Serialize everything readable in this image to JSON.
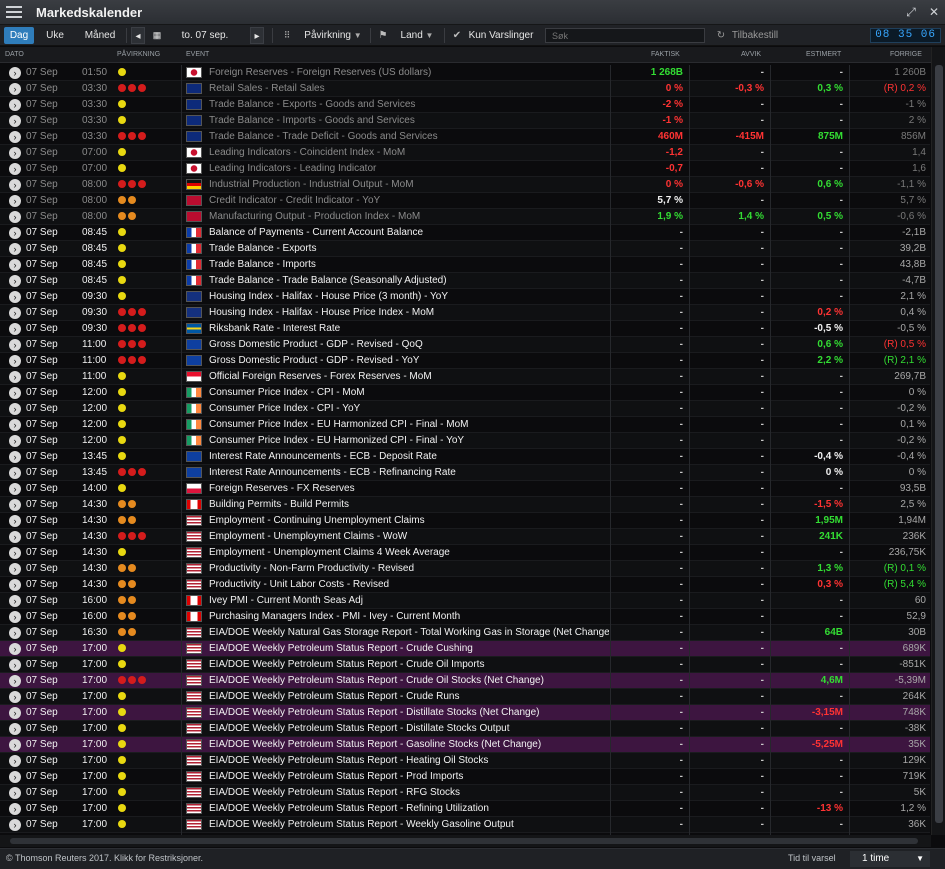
{
  "window": {
    "title": "Markedskalender",
    "menu_icon": "hamburger-icon",
    "restore_icon": "restore-icon",
    "close_icon": "close-icon"
  },
  "toolbar": {
    "tabs": [
      "Dag",
      "Uke",
      "Måned"
    ],
    "active_tab": "Dag",
    "date": "to. 07 sep.",
    "impact_label": "Påvirkning",
    "country_label": "Land",
    "alerts_label": "Kun Varslinger",
    "search_placeholder": "Søk",
    "reset_label": "Tilbakestill",
    "clock": "08 35 06"
  },
  "columns": {
    "date": "DATO",
    "impact": "PÅVIRKNING",
    "event": "EVENT",
    "actual": "FAKTISK",
    "deviation": "AVVIK",
    "estimate": "ESTIMERT",
    "previous": "FORRIGE"
  },
  "colors": {
    "positive": "#33dd33",
    "negative": "#ff3333",
    "impact_high": "#d41c1c",
    "impact_med": "#e58a1f",
    "impact_low": "#e8d810",
    "highlight_row": "#3d1540"
  },
  "rows": [
    {
      "date": "07 Sep",
      "time": "01:50",
      "impact": 1,
      "flag": "jp",
      "event": "Foreign Reserves - Foreign Reserves (US dollars)",
      "actual": "1 268B",
      "act_c": "pos",
      "dev": "-",
      "dev_c": "",
      "est": "-",
      "est_c": "",
      "prev": "1 260B",
      "style": "dim"
    },
    {
      "date": "07 Sep",
      "time": "03:30",
      "impact": 3,
      "flag": "au",
      "event": "Retail Sales - Retail Sales",
      "actual": "0 %",
      "act_c": "neg",
      "dev": "-0,3 %",
      "dev_c": "neg",
      "est": "0,3 %",
      "est_c": "pos",
      "prev": "(R) 0,2 %",
      "prev_c": "neg",
      "style": "dim"
    },
    {
      "date": "07 Sep",
      "time": "03:30",
      "impact": 1,
      "flag": "au",
      "event": "Trade Balance - Exports - Goods and Services",
      "actual": "-2 %",
      "act_c": "neg",
      "dev": "-",
      "dev_c": "",
      "est": "-",
      "est_c": "",
      "prev": "-1 %",
      "style": "dim"
    },
    {
      "date": "07 Sep",
      "time": "03:30",
      "impact": 1,
      "flag": "au",
      "event": "Trade Balance - Imports - Goods and Services",
      "actual": "-1 %",
      "act_c": "neg",
      "dev": "-",
      "dev_c": "",
      "est": "-",
      "est_c": "",
      "prev": "2 %",
      "style": "dim"
    },
    {
      "date": "07 Sep",
      "time": "03:30",
      "impact": 3,
      "flag": "au",
      "event": "Trade Balance - Trade Deficit - Goods and Services",
      "actual": "460M",
      "act_c": "neg",
      "dev": "-415M",
      "dev_c": "neg",
      "est": "875M",
      "est_c": "pos",
      "prev": "856M",
      "style": "dim"
    },
    {
      "date": "07 Sep",
      "time": "07:00",
      "impact": 1,
      "flag": "jp",
      "event": "Leading Indicators - Coincident Index - MoM",
      "actual": "-1,2",
      "act_c": "neg",
      "dev": "-",
      "dev_c": "",
      "est": "-",
      "est_c": "",
      "prev": "1,4",
      "style": "dim"
    },
    {
      "date": "07 Sep",
      "time": "07:00",
      "impact": 1,
      "flag": "jp",
      "event": "Leading Indicators - Leading Indicator",
      "actual": "-0,7",
      "act_c": "neg",
      "dev": "-",
      "dev_c": "",
      "est": "-",
      "est_c": "",
      "prev": "1,6",
      "style": "dim"
    },
    {
      "date": "07 Sep",
      "time": "08:00",
      "impact": 3,
      "flag": "de",
      "event": "Industrial Production - Industrial Output - MoM",
      "actual": "0 %",
      "act_c": "neg",
      "dev": "-0,6 %",
      "dev_c": "neg",
      "est": "0,6 %",
      "est_c": "pos",
      "prev": "-1,1 %",
      "style": "dim"
    },
    {
      "date": "07 Sep",
      "time": "08:00",
      "impact": 2,
      "flag": "no",
      "event": "Credit Indicator - Credit Indicator - YoY",
      "actual": "5,7 %",
      "act_c": "wht",
      "dev": "-",
      "dev_c": "",
      "est": "-",
      "est_c": "",
      "prev": "5,7 %",
      "style": "dim"
    },
    {
      "date": "07 Sep",
      "time": "08:00",
      "impact": 2,
      "flag": "no",
      "event": "Manufacturing Output - Production Index - MoM",
      "actual": "1,9 %",
      "act_c": "pos",
      "dev": "1,4 %",
      "dev_c": "pos",
      "est": "0,5 %",
      "est_c": "pos",
      "prev": "-0,6 %",
      "style": "dim"
    },
    {
      "date": "07 Sep",
      "time": "08:45",
      "impact": 1,
      "flag": "fr",
      "event": "Balance of Payments - Current Account Balance",
      "actual": "-",
      "act_c": "",
      "dev": "-",
      "dev_c": "",
      "est": "-",
      "est_c": "",
      "prev": "-2,1B",
      "style": "bold"
    },
    {
      "date": "07 Sep",
      "time": "08:45",
      "impact": 1,
      "flag": "fr",
      "event": "Trade Balance - Exports",
      "actual": "-",
      "act_c": "",
      "dev": "-",
      "dev_c": "",
      "est": "-",
      "est_c": "",
      "prev": "39,2B",
      "style": "bold"
    },
    {
      "date": "07 Sep",
      "time": "08:45",
      "impact": 1,
      "flag": "fr",
      "event": "Trade Balance - Imports",
      "actual": "-",
      "act_c": "",
      "dev": "-",
      "dev_c": "",
      "est": "-",
      "est_c": "",
      "prev": "43,8B",
      "style": "bold"
    },
    {
      "date": "07 Sep",
      "time": "08:45",
      "impact": 1,
      "flag": "fr",
      "event": "Trade Balance - Trade Balance (Seasonally Adjusted)",
      "actual": "-",
      "act_c": "",
      "dev": "-",
      "dev_c": "",
      "est": "-",
      "est_c": "",
      "prev": "-4,7B",
      "style": "bold"
    },
    {
      "date": "07 Sep",
      "time": "09:30",
      "impact": 1,
      "flag": "gb",
      "event": "Housing Index - Halifax - House Price (3 month) - YoY",
      "actual": "-",
      "act_c": "",
      "dev": "-",
      "dev_c": "",
      "est": "-",
      "est_c": "",
      "prev": "2,1 %",
      "style": "bold"
    },
    {
      "date": "07 Sep",
      "time": "09:30",
      "impact": 3,
      "flag": "gb",
      "event": "Housing Index - Halifax - House Price Index - MoM",
      "actual": "-",
      "act_c": "",
      "dev": "-",
      "dev_c": "",
      "est": "0,2 %",
      "est_c": "neg",
      "prev": "0,4 %",
      "style": "bold"
    },
    {
      "date": "07 Sep",
      "time": "09:30",
      "impact": 3,
      "flag": "se",
      "event": "Riksbank Rate - Interest Rate",
      "actual": "-",
      "act_c": "",
      "dev": "-",
      "dev_c": "",
      "est": "-0,5 %",
      "est_c": "wht",
      "prev": "-0,5 %",
      "style": "bold"
    },
    {
      "date": "07 Sep",
      "time": "11:00",
      "impact": 3,
      "flag": "eu",
      "event": "Gross Domestic Product - GDP - Revised - QoQ",
      "actual": "-",
      "act_c": "",
      "dev": "-",
      "dev_c": "",
      "est": "0,6 %",
      "est_c": "pos",
      "prev": "(R) 0,5 %",
      "prev_c": "neg",
      "style": "bold"
    },
    {
      "date": "07 Sep",
      "time": "11:00",
      "impact": 3,
      "flag": "eu",
      "event": "Gross Domestic Product - GDP - Revised - YoY",
      "actual": "-",
      "act_c": "",
      "dev": "-",
      "dev_c": "",
      "est": "2,2 %",
      "est_c": "pos",
      "prev": "(R) 2,1 %",
      "prev_c": "pos",
      "style": "bold"
    },
    {
      "date": "07 Sep",
      "time": "11:00",
      "impact": 1,
      "flag": "sg",
      "event": "Official Foreign Reserves - Forex Reserves - MoM",
      "actual": "-",
      "act_c": "",
      "dev": "-",
      "dev_c": "",
      "est": "-",
      "est_c": "",
      "prev": "269,7B",
      "style": "bold"
    },
    {
      "date": "07 Sep",
      "time": "12:00",
      "impact": 1,
      "flag": "ie",
      "event": "Consumer Price Index - CPI - MoM",
      "actual": "-",
      "act_c": "",
      "dev": "-",
      "dev_c": "",
      "est": "-",
      "est_c": "",
      "prev": "0 %",
      "style": "bold"
    },
    {
      "date": "07 Sep",
      "time": "12:00",
      "impact": 1,
      "flag": "ie",
      "event": "Consumer Price Index - CPI - YoY",
      "actual": "-",
      "act_c": "",
      "dev": "-",
      "dev_c": "",
      "est": "-",
      "est_c": "",
      "prev": "-0,2 %",
      "style": "bold"
    },
    {
      "date": "07 Sep",
      "time": "12:00",
      "impact": 1,
      "flag": "ie",
      "event": "Consumer Price Index - EU Harmonized CPI - Final - MoM",
      "actual": "-",
      "act_c": "",
      "dev": "-",
      "dev_c": "",
      "est": "-",
      "est_c": "",
      "prev": "0,1 %",
      "style": "bold"
    },
    {
      "date": "07 Sep",
      "time": "12:00",
      "impact": 1,
      "flag": "ie",
      "event": "Consumer Price Index - EU Harmonized CPI - Final - YoY",
      "actual": "-",
      "act_c": "",
      "dev": "-",
      "dev_c": "",
      "est": "-",
      "est_c": "",
      "prev": "-0,2 %",
      "style": "bold"
    },
    {
      "date": "07 Sep",
      "time": "13:45",
      "impact": 1,
      "flag": "eu",
      "event": "Interest Rate Announcements - ECB - Deposit Rate",
      "actual": "-",
      "act_c": "",
      "dev": "-",
      "dev_c": "",
      "est": "-0,4 %",
      "est_c": "wht",
      "prev": "-0,4 %",
      "style": "bold"
    },
    {
      "date": "07 Sep",
      "time": "13:45",
      "impact": 3,
      "flag": "eu",
      "event": "Interest Rate Announcements - ECB - Refinancing Rate",
      "actual": "-",
      "act_c": "",
      "dev": "-",
      "dev_c": "",
      "est": "0 %",
      "est_c": "wht",
      "prev": "0 %",
      "style": "bold"
    },
    {
      "date": "07 Sep",
      "time": "14:00",
      "impact": 1,
      "flag": "pl",
      "event": "Foreign Reserves - FX Reserves",
      "actual": "-",
      "act_c": "",
      "dev": "-",
      "dev_c": "",
      "est": "-",
      "est_c": "",
      "prev": "93,5B",
      "style": "bold"
    },
    {
      "date": "07 Sep",
      "time": "14:30",
      "impact": 2,
      "flag": "ca",
      "event": "Building Permits - Build Permits",
      "actual": "-",
      "act_c": "",
      "dev": "-",
      "dev_c": "",
      "est": "-1,5 %",
      "est_c": "neg",
      "prev": "2,5 %",
      "style": "bold"
    },
    {
      "date": "07 Sep",
      "time": "14:30",
      "impact": 2,
      "flag": "us",
      "event": "Employment - Continuing Unemployment Claims",
      "actual": "-",
      "act_c": "",
      "dev": "-",
      "dev_c": "",
      "est": "1,95M",
      "est_c": "pos",
      "prev": "1,94M",
      "style": "bold"
    },
    {
      "date": "07 Sep",
      "time": "14:30",
      "impact": 3,
      "flag": "us",
      "event": "Employment - Unemployment Claims - WoW",
      "actual": "-",
      "act_c": "",
      "dev": "-",
      "dev_c": "",
      "est": "241K",
      "est_c": "pos",
      "prev": "236K",
      "style": "bold"
    },
    {
      "date": "07 Sep",
      "time": "14:30",
      "impact": 1,
      "flag": "us",
      "event": "Employment - Unemployment Claims 4 Week Average",
      "actual": "-",
      "act_c": "",
      "dev": "-",
      "dev_c": "",
      "est": "-",
      "est_c": "",
      "prev": "236,75K",
      "style": "bold"
    },
    {
      "date": "07 Sep",
      "time": "14:30",
      "impact": 2,
      "flag": "us",
      "event": "Productivity - Non-Farm Productivity - Revised",
      "actual": "-",
      "act_c": "",
      "dev": "-",
      "dev_c": "",
      "est": "1,3 %",
      "est_c": "pos",
      "prev": "(R) 0,1 %",
      "prev_c": "pos",
      "style": "bold"
    },
    {
      "date": "07 Sep",
      "time": "14:30",
      "impact": 2,
      "flag": "us",
      "event": "Productivity - Unit Labor Costs - Revised",
      "actual": "-",
      "act_c": "",
      "dev": "-",
      "dev_c": "",
      "est": "0,3 %",
      "est_c": "neg",
      "prev": "(R) 5,4 %",
      "prev_c": "pos",
      "style": "bold"
    },
    {
      "date": "07 Sep",
      "time": "16:00",
      "impact": 2,
      "flag": "ca",
      "event": "Ivey PMI - Current Month Seas Adj",
      "actual": "-",
      "act_c": "",
      "dev": "-",
      "dev_c": "",
      "est": "-",
      "est_c": "",
      "prev": "60",
      "style": "bold"
    },
    {
      "date": "07 Sep",
      "time": "16:00",
      "impact": 2,
      "flag": "ca",
      "event": "Purchasing Managers Index - PMI - Ivey - Current Month",
      "actual": "-",
      "act_c": "",
      "dev": "-",
      "dev_c": "",
      "est": "-",
      "est_c": "",
      "prev": "52,9",
      "style": "bold"
    },
    {
      "date": "07 Sep",
      "time": "16:30",
      "impact": 2,
      "flag": "us",
      "event": "EIA/DOE Weekly Natural Gas Storage Report - Total Working Gas in Storage (Net Change)",
      "actual": "-",
      "act_c": "",
      "dev": "-",
      "dev_c": "",
      "est": "64B",
      "est_c": "pos",
      "prev": "30B",
      "style": "bold"
    },
    {
      "date": "07 Sep",
      "time": "17:00",
      "impact": 1,
      "flag": "us",
      "event": "EIA/DOE Weekly Petroleum Status Report - Crude Cushing",
      "actual": "-",
      "act_c": "",
      "dev": "-",
      "dev_c": "",
      "est": "-",
      "est_c": "",
      "prev": "689K",
      "style": "hl"
    },
    {
      "date": "07 Sep",
      "time": "17:00",
      "impact": 1,
      "flag": "us",
      "event": "EIA/DOE Weekly Petroleum Status Report - Crude Oil Imports",
      "actual": "-",
      "act_c": "",
      "dev": "-",
      "dev_c": "",
      "est": "-",
      "est_c": "",
      "prev": "-851K",
      "style": "bold"
    },
    {
      "date": "07 Sep",
      "time": "17:00",
      "impact": 3,
      "flag": "us",
      "event": "EIA/DOE Weekly Petroleum Status Report - Crude Oil Stocks (Net Change)",
      "actual": "-",
      "act_c": "",
      "dev": "-",
      "dev_c": "",
      "est": "4,6M",
      "est_c": "pos",
      "prev": "-5,39M",
      "style": "hl"
    },
    {
      "date": "07 Sep",
      "time": "17:00",
      "impact": 1,
      "flag": "us",
      "event": "EIA/DOE Weekly Petroleum Status Report - Crude Runs",
      "actual": "-",
      "act_c": "",
      "dev": "-",
      "dev_c": "",
      "est": "-",
      "est_c": "",
      "prev": "264K",
      "style": "bold"
    },
    {
      "date": "07 Sep",
      "time": "17:00",
      "impact": 1,
      "flag": "us",
      "event": "EIA/DOE Weekly Petroleum Status Report - Distillate Stocks (Net Change)",
      "actual": "-",
      "act_c": "",
      "dev": "-",
      "dev_c": "",
      "est": "-3,15M",
      "est_c": "neg",
      "prev": "748K",
      "style": "hl"
    },
    {
      "date": "07 Sep",
      "time": "17:00",
      "impact": 1,
      "flag": "us",
      "event": "EIA/DOE Weekly Petroleum Status Report - Distillate Stocks Output",
      "actual": "-",
      "act_c": "",
      "dev": "-",
      "dev_c": "",
      "est": "-",
      "est_c": "",
      "prev": "-38K",
      "style": "bold"
    },
    {
      "date": "07 Sep",
      "time": "17:00",
      "impact": 1,
      "flag": "us",
      "event": "EIA/DOE Weekly Petroleum Status Report - Gasoline Stocks (Net Change)",
      "actual": "-",
      "act_c": "",
      "dev": "-",
      "dev_c": "",
      "est": "-5,25M",
      "est_c": "neg",
      "prev": "35K",
      "style": "hl"
    },
    {
      "date": "07 Sep",
      "time": "17:00",
      "impact": 1,
      "flag": "us",
      "event": "EIA/DOE Weekly Petroleum Status Report - Heating Oil Stocks",
      "actual": "-",
      "act_c": "",
      "dev": "-",
      "dev_c": "",
      "est": "-",
      "est_c": "",
      "prev": "129K",
      "style": "bold"
    },
    {
      "date": "07 Sep",
      "time": "17:00",
      "impact": 1,
      "flag": "us",
      "event": "EIA/DOE Weekly Petroleum Status Report - Prod Imports",
      "actual": "-",
      "act_c": "",
      "dev": "-",
      "dev_c": "",
      "est": "-",
      "est_c": "",
      "prev": "719K",
      "style": "bold"
    },
    {
      "date": "07 Sep",
      "time": "17:00",
      "impact": 1,
      "flag": "us",
      "event": "EIA/DOE Weekly Petroleum Status Report - RFG Stocks",
      "actual": "-",
      "act_c": "",
      "dev": "-",
      "dev_c": "",
      "est": "-",
      "est_c": "",
      "prev": "5K",
      "style": "bold"
    },
    {
      "date": "07 Sep",
      "time": "17:00",
      "impact": 1,
      "flag": "us",
      "event": "EIA/DOE Weekly Petroleum Status Report - Refining Utilization",
      "actual": "-",
      "act_c": "",
      "dev": "-",
      "dev_c": "",
      "est": "-13 %",
      "est_c": "neg",
      "prev": "1,2 %",
      "style": "bold"
    },
    {
      "date": "07 Sep",
      "time": "17:00",
      "impact": 1,
      "flag": "us",
      "event": "EIA/DOE Weekly Petroleum Status Report - Weekly Gasoline Output",
      "actual": "-",
      "act_c": "",
      "dev": "-",
      "dev_c": "",
      "est": "-",
      "est_c": "",
      "prev": "36K",
      "style": "bold"
    }
  ],
  "status": {
    "copyright": "© Thomson Reuters 2017. Klikk for Restriksjoner.",
    "alert_label": "Tid til varsel",
    "alert_value": "1 time"
  }
}
